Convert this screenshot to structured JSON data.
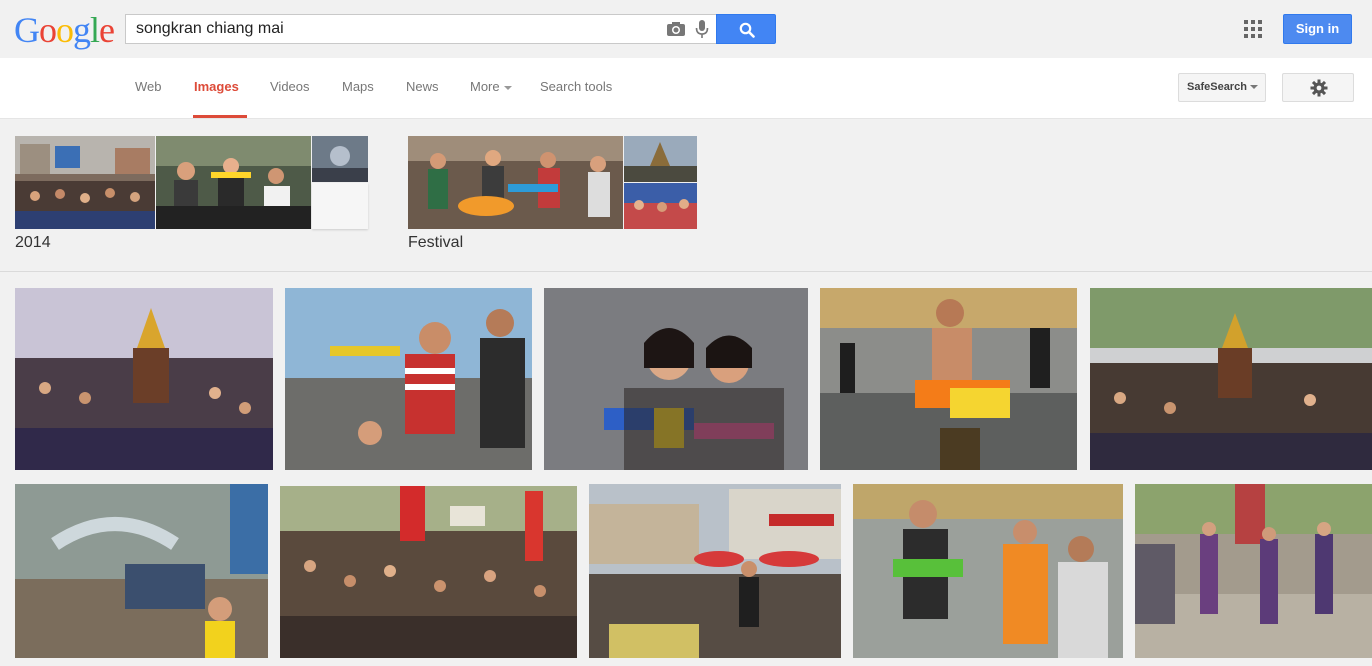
{
  "logo": {
    "letters": [
      {
        "char": "G",
        "color": "#4285f4"
      },
      {
        "char": "o",
        "color": "#ea4335"
      },
      {
        "char": "o",
        "color": "#fbbc05"
      },
      {
        "char": "g",
        "color": "#4285f4"
      },
      {
        "char": "l",
        "color": "#34a853"
      },
      {
        "char": "e",
        "color": "#ea4335"
      }
    ]
  },
  "search": {
    "query": "songkran chiang mai",
    "camera_icon": "camera-icon",
    "mic_icon": "microphone-icon",
    "button_icon": "magnifier-icon"
  },
  "header": {
    "apps_icon": "apps-grid-icon",
    "signin_label": "Sign in"
  },
  "nav": {
    "tabs": [
      {
        "label": "Web",
        "active": false
      },
      {
        "label": "Images",
        "active": true
      },
      {
        "label": "Videos",
        "active": false
      },
      {
        "label": "Maps",
        "active": false
      },
      {
        "label": "News",
        "active": false
      },
      {
        "label": "More",
        "active": false
      },
      {
        "label": "Search tools",
        "active": false
      }
    ],
    "safesearch_label": "SafeSearch",
    "settings_icon": "gear-icon"
  },
  "collections": [
    {
      "label": "2014"
    },
    {
      "label": "Festival"
    }
  ],
  "colors": {
    "accent_red": "#dd4b39",
    "button_blue": "#4285f4",
    "text_gray": "#777777"
  }
}
